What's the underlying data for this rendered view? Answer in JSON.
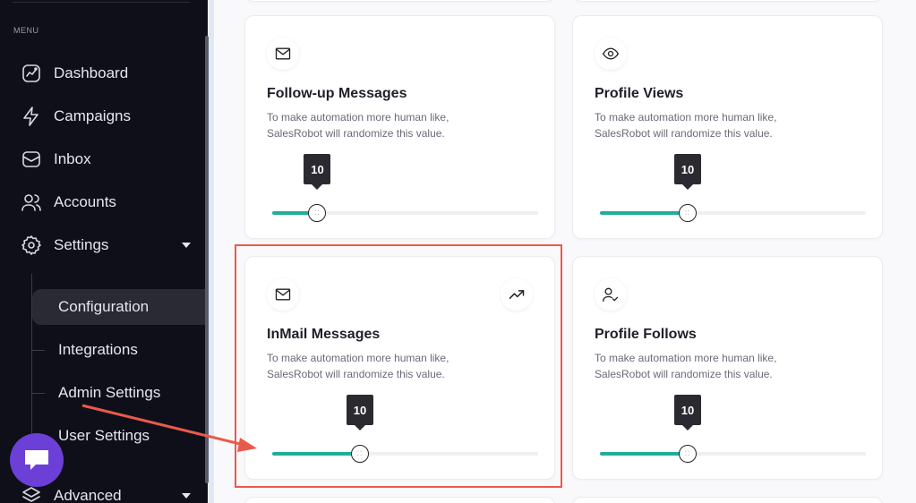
{
  "sidebar": {
    "menu_heading": "MENU",
    "items": [
      {
        "label": "Dashboard",
        "icon": "dashboard-icon"
      },
      {
        "label": "Campaigns",
        "icon": "lightning-icon"
      },
      {
        "label": "Inbox",
        "icon": "inbox-icon"
      },
      {
        "label": "Accounts",
        "icon": "users-icon"
      },
      {
        "label": "Settings",
        "icon": "gear-icon"
      },
      {
        "label": "Advanced",
        "icon": "layers-icon"
      }
    ],
    "sub_items": [
      {
        "label": "Configuration",
        "active": true
      },
      {
        "label": "Integrations",
        "active": false
      },
      {
        "label": "Admin Settings",
        "active": false
      },
      {
        "label": "User Settings",
        "active": false
      }
    ]
  },
  "cards": [
    {
      "title": "Follow-up Messages",
      "description": "To make automation more human like, SalesRobot will randomize this value.",
      "icon": "mail-icon",
      "value": 10,
      "fill_fraction": 0.17
    },
    {
      "title": "Profile Views",
      "description": "To make automation more human like, SalesRobot will randomize this value.",
      "icon": "eye-icon",
      "value": 10,
      "fill_fraction": 0.33
    },
    {
      "title": "InMail Messages",
      "description": "To make automation more human like, SalesRobot will randomize this value.",
      "icon": "mail-icon",
      "secondary_icon": "trending-up-icon",
      "value": 10,
      "fill_fraction": 0.33
    },
    {
      "title": "Profile Follows",
      "description": "To make automation more human like, SalesRobot will randomize this value.",
      "icon": "user-check-icon",
      "value": 10,
      "fill_fraction": 0.33
    }
  ],
  "colors": {
    "slider_fill": "#1fae9a",
    "highlight": "#ea5a4a",
    "chat_button": "#6c3fd6"
  }
}
